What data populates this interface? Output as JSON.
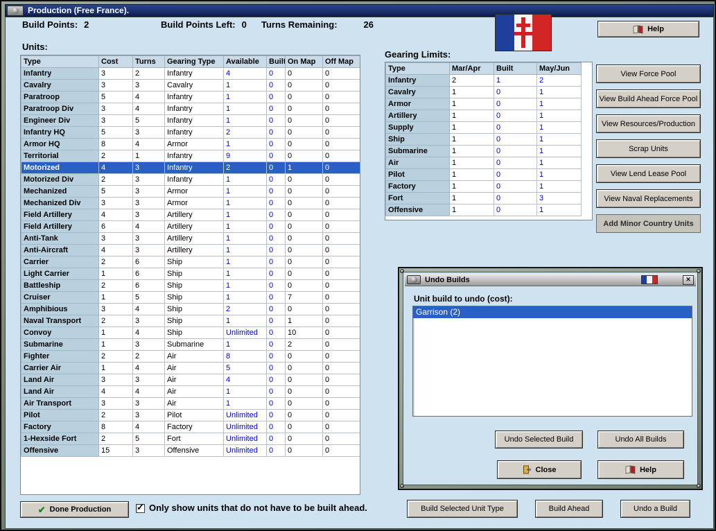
{
  "titlebar": {
    "title": "Production (Free France)."
  },
  "header": {
    "build_points_label": "Build Points:",
    "build_points_value": "2",
    "build_points_left_label": "Build Points Left:",
    "build_points_left_value": "0",
    "turns_remaining_label": "Turns Remaining:",
    "turns_remaining_value": "26",
    "help_label": "Help"
  },
  "units": {
    "label": "Units:",
    "columns": [
      "Type",
      "Cost",
      "Turns",
      "Gearing Type",
      "Available",
      "Built",
      "On Map",
      "Off Map"
    ],
    "selected_row_index": 8,
    "rows": [
      [
        "Infantry",
        "3",
        "2",
        "Infantry",
        "4",
        "0",
        "0",
        "0"
      ],
      [
        "Cavalry",
        "3",
        "3",
        "Cavalry",
        "1",
        "0",
        "0",
        "0"
      ],
      [
        "Paratroop",
        "5",
        "4",
        "Infantry",
        "1",
        "0",
        "0",
        "0"
      ],
      [
        "Paratroop Div",
        "3",
        "4",
        "Infantry",
        "1",
        "0",
        "0",
        "0"
      ],
      [
        "Engineer Div",
        "3",
        "5",
        "Infantry",
        "1",
        "0",
        "0",
        "0"
      ],
      [
        "Infantry HQ",
        "5",
        "3",
        "Infantry",
        "2",
        "0",
        "0",
        "0"
      ],
      [
        "Armor HQ",
        "8",
        "4",
        "Armor",
        "1",
        "0",
        "0",
        "0"
      ],
      [
        "Territorial",
        "2",
        "1",
        "Infantry",
        "9",
        "0",
        "0",
        "0"
      ],
      [
        "Motorized",
        "4",
        "3",
        "Infantry",
        "2",
        "0",
        "1",
        "0"
      ],
      [
        "Motorized Div",
        "2",
        "3",
        "Infantry",
        "1",
        "0",
        "0",
        "0"
      ],
      [
        "Mechanized",
        "5",
        "3",
        "Armor",
        "1",
        "0",
        "0",
        "0"
      ],
      [
        "Mechanized Div",
        "3",
        "3",
        "Armor",
        "1",
        "0",
        "0",
        "0"
      ],
      [
        "Field Artillery",
        "4",
        "3",
        "Artillery",
        "1",
        "0",
        "0",
        "0"
      ],
      [
        "Field Artillery",
        "6",
        "4",
        "Artillery",
        "1",
        "0",
        "0",
        "0"
      ],
      [
        "Anti-Tank",
        "3",
        "3",
        "Artillery",
        "1",
        "0",
        "0",
        "0"
      ],
      [
        "Anti-Aircraft",
        "4",
        "3",
        "Artillery",
        "1",
        "0",
        "0",
        "0"
      ],
      [
        "Carrier",
        "2",
        "6",
        "Ship",
        "1",
        "0",
        "0",
        "0"
      ],
      [
        "Light Carrier",
        "1",
        "6",
        "Ship",
        "1",
        "0",
        "0",
        "0"
      ],
      [
        "Battleship",
        "2",
        "6",
        "Ship",
        "1",
        "0",
        "0",
        "0"
      ],
      [
        "Cruiser",
        "1",
        "5",
        "Ship",
        "1",
        "0",
        "7",
        "0"
      ],
      [
        "Amphibious",
        "3",
        "4",
        "Ship",
        "2",
        "0",
        "0",
        "0"
      ],
      [
        "Naval Transport",
        "2",
        "3",
        "Ship",
        "1",
        "0",
        "1",
        "0"
      ],
      [
        "Convoy",
        "1",
        "4",
        "Ship",
        "Unlimited",
        "0",
        "10",
        "0"
      ],
      [
        "Submarine",
        "1",
        "3",
        "Submarine",
        "1",
        "0",
        "2",
        "0"
      ],
      [
        "Fighter",
        "2",
        "2",
        "Air",
        "8",
        "0",
        "0",
        "0"
      ],
      [
        "Carrier Air",
        "1",
        "4",
        "Air",
        "5",
        "0",
        "0",
        "0"
      ],
      [
        "Land Air",
        "3",
        "3",
        "Air",
        "4",
        "0",
        "0",
        "0"
      ],
      [
        "Land Air",
        "4",
        "4",
        "Air",
        "1",
        "0",
        "0",
        "0"
      ],
      [
        "Air Transport",
        "3",
        "3",
        "Air",
        "1",
        "0",
        "0",
        "0"
      ],
      [
        "Pilot",
        "2",
        "3",
        "Pilot",
        "Unlimited",
        "0",
        "0",
        "0"
      ],
      [
        "Factory",
        "8",
        "4",
        "Factory",
        "Unlimited",
        "0",
        "0",
        "0"
      ],
      [
        "1-Hexside Fort",
        "2",
        "5",
        "Fort",
        "Unlimited",
        "0",
        "0",
        "0"
      ],
      [
        "Offensive",
        "15",
        "3",
        "Offensive",
        "Unlimited",
        "0",
        "0",
        "0"
      ]
    ]
  },
  "gearing": {
    "label": "Gearing Limits:",
    "columns": [
      "Type",
      "Mar/Apr",
      "Built",
      "May/Jun"
    ],
    "rows": [
      [
        "Infantry",
        "2",
        "1",
        "2"
      ],
      [
        "Cavalry",
        "1",
        "0",
        "1"
      ],
      [
        "Armor",
        "1",
        "0",
        "1"
      ],
      [
        "Artillery",
        "1",
        "0",
        "1"
      ],
      [
        "Supply",
        "1",
        "0",
        "1"
      ],
      [
        "Ship",
        "1",
        "0",
        "1"
      ],
      [
        "Submarine",
        "1",
        "0",
        "1"
      ],
      [
        "Air",
        "1",
        "0",
        "1"
      ],
      [
        "Pilot",
        "1",
        "0",
        "1"
      ],
      [
        "Factory",
        "1",
        "0",
        "1"
      ],
      [
        "Fort",
        "1",
        "0",
        "3"
      ],
      [
        "Offensive",
        "1",
        "0",
        "1"
      ]
    ]
  },
  "side_buttons": [
    {
      "label": "View Force Pool",
      "disabled": false
    },
    {
      "label": "View Build Ahead Force Pool",
      "disabled": false
    },
    {
      "label": "View Resources/Production",
      "disabled": false
    },
    {
      "label": "Scrap Units",
      "disabled": false
    },
    {
      "label": "View Lend Lease Pool",
      "disabled": false
    },
    {
      "label": "View Naval Replacements",
      "disabled": false
    },
    {
      "label": "Add Minor Country Units",
      "disabled": true
    }
  ],
  "undo_window": {
    "title": "Undo Builds",
    "list_label": "Unit build to undo (cost):",
    "items": [
      {
        "label": "Garrison (2)",
        "selected": true
      }
    ],
    "undo_selected_label": "Undo Selected Build",
    "undo_all_label": "Undo All Builds",
    "close_label": "Close",
    "help_label": "Help"
  },
  "bottom": {
    "done_label": "Done Production",
    "filter_checked": true,
    "filter_label": "Only show units that do not have to be built ahead.",
    "build_selected_label": "Build Selected Unit Type",
    "build_ahead_label": "Build Ahead",
    "undo_build_label": "Undo a Build"
  },
  "colors": {
    "selection_blue": "#2a5fc4",
    "value_blue": "#0000cd",
    "window_bg": "#cfe2ef",
    "flag_blue": "#1e3f9c",
    "flag_red": "#d22525"
  }
}
